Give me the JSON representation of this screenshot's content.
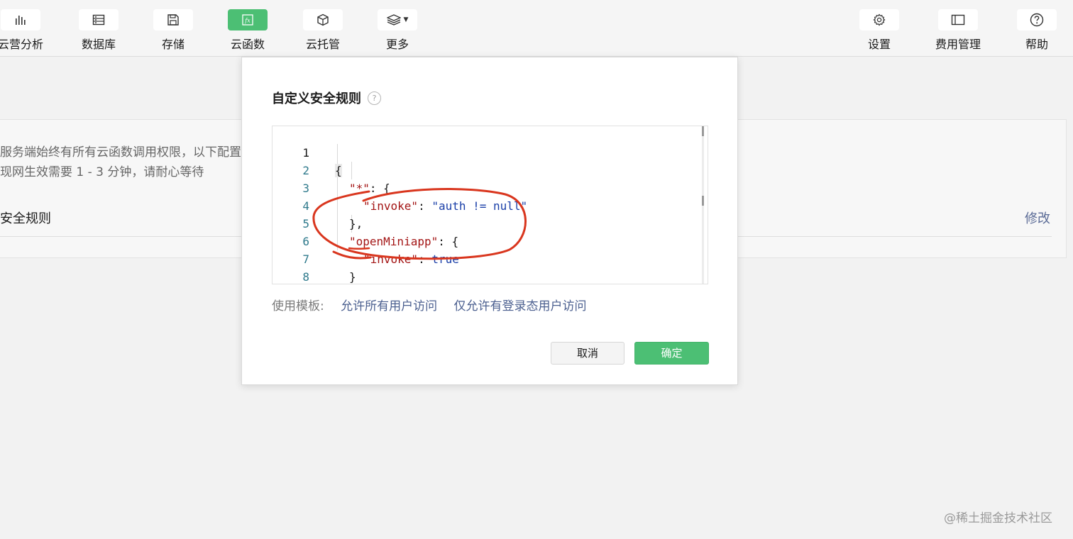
{
  "toolbar": {
    "left_items": [
      {
        "label": "云营分析",
        "icon": "bar-chart-icon"
      },
      {
        "label": "数据库",
        "icon": "database-icon"
      },
      {
        "label": "存储",
        "icon": "save-icon"
      },
      {
        "label": "云函数",
        "icon": "function-icon",
        "active": true
      },
      {
        "label": "云托管",
        "icon": "cube-icon"
      },
      {
        "label": "更多",
        "icon": "layers-icon"
      }
    ],
    "right_items": [
      {
        "label": "设置",
        "icon": "gear-icon"
      },
      {
        "label": "费用管理",
        "icon": "ticket-icon"
      },
      {
        "label": "帮助",
        "icon": "question-icon"
      }
    ]
  },
  "background": {
    "desc_line1": "服务端始终有所有云函数调用权限，以下配置",
    "desc_line2": "现网生效需要 1 - 3 分钟，请耐心等待",
    "rule_title": "安全规则",
    "edit_link": "修改"
  },
  "modal": {
    "title": "自定义安全规则",
    "help_glyph": "?",
    "editor": {
      "line_numbers": [
        "1",
        "2",
        "3",
        "4",
        "5",
        "6",
        "7",
        "8"
      ],
      "tokens": {
        "open_brace": "{",
        "star_key": "\"*\"",
        "colon_open": ": {",
        "invoke_key": "\"invoke\"",
        "colon": ": ",
        "auth_value": "\"auth != null\"",
        "close_brace_comma": "},",
        "openminiapp_key": "\"openMiniapp\"",
        "true_value": "true",
        "close_brace": "}"
      }
    },
    "templates": {
      "label": "使用模板:",
      "links": [
        "允许所有用户访问",
        "仅允许有登录态用户访问"
      ]
    },
    "cancel_label": "取消",
    "confirm_label": "确定"
  },
  "colors": {
    "accent_green": "#4cbf74",
    "annotation_red": "#d9361e",
    "link_blue": "#4b5f8f"
  },
  "watermark": "@稀土掘金技术社区"
}
